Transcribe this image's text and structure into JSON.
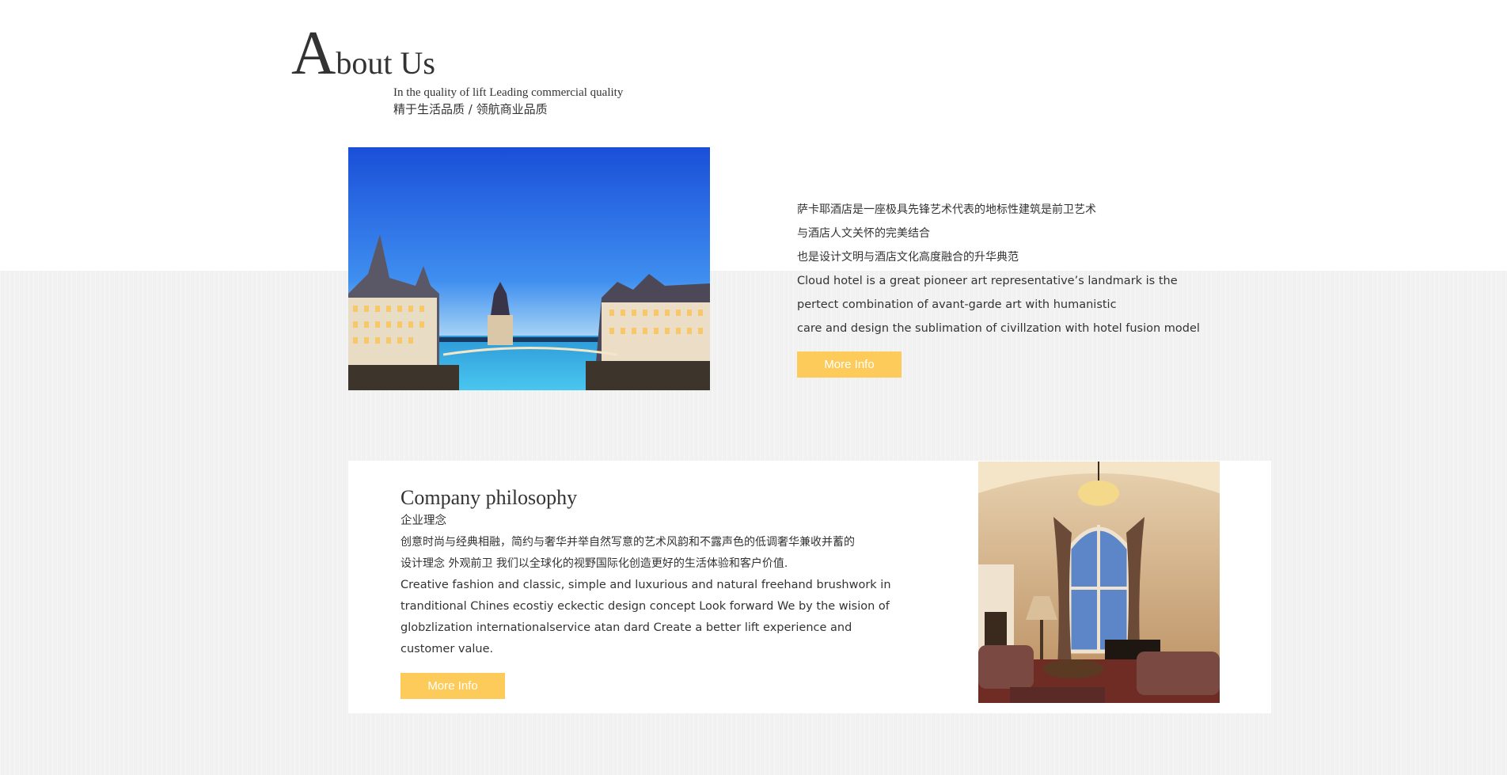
{
  "about": {
    "title_first_letter": "A",
    "title_rest": "bout Us",
    "subtitle_en": "In the quality of lift Leading commercial quality",
    "subtitle_cn": "精于生活品质 / 领航商业品质",
    "hotel_image_icon": "hotel-photo",
    "paragraph_lines": [
      "萨卡耶酒店是一座极具先锋艺术代表的地标性建筑是前卫艺术",
      "与酒店人文关怀的完美结合",
      "也是设计文明与酒店文化高度融合的升华典范",
      "Cloud hotel is a great pioneer art representative’s landmark is the",
      "pertect combination of avant-garde art with humanistic",
      "care and design the sublimation of civillzation with hotel fusion model"
    ],
    "button_label": "More Info"
  },
  "philosophy": {
    "title": "Company philosophy",
    "subtitle_cn": "企业理念",
    "body_lines": [
      "创意时尚与经典相融，简约与奢华并举自然写意的艺术风韵和不露声色的低调奢华兼收并蓄的",
      "设计理念 外观前卫 我们以全球化的视野国际化创造更好的生活体验和客户价值.",
      "Creative fashion and classic, simple and luxurious and natural freehand brushwork in",
      "tranditional Chines ecostiy eckectic design concept Look forward We by the wision of",
      "globzlization internationalservice atan dard Create a better lift experience and",
      "customer value."
    ],
    "button_label": "More Info",
    "room_image_icon": "interior-photo"
  },
  "colors": {
    "accent": "#fdcb5a",
    "text": "#333333",
    "background": "#f2f2f2"
  }
}
